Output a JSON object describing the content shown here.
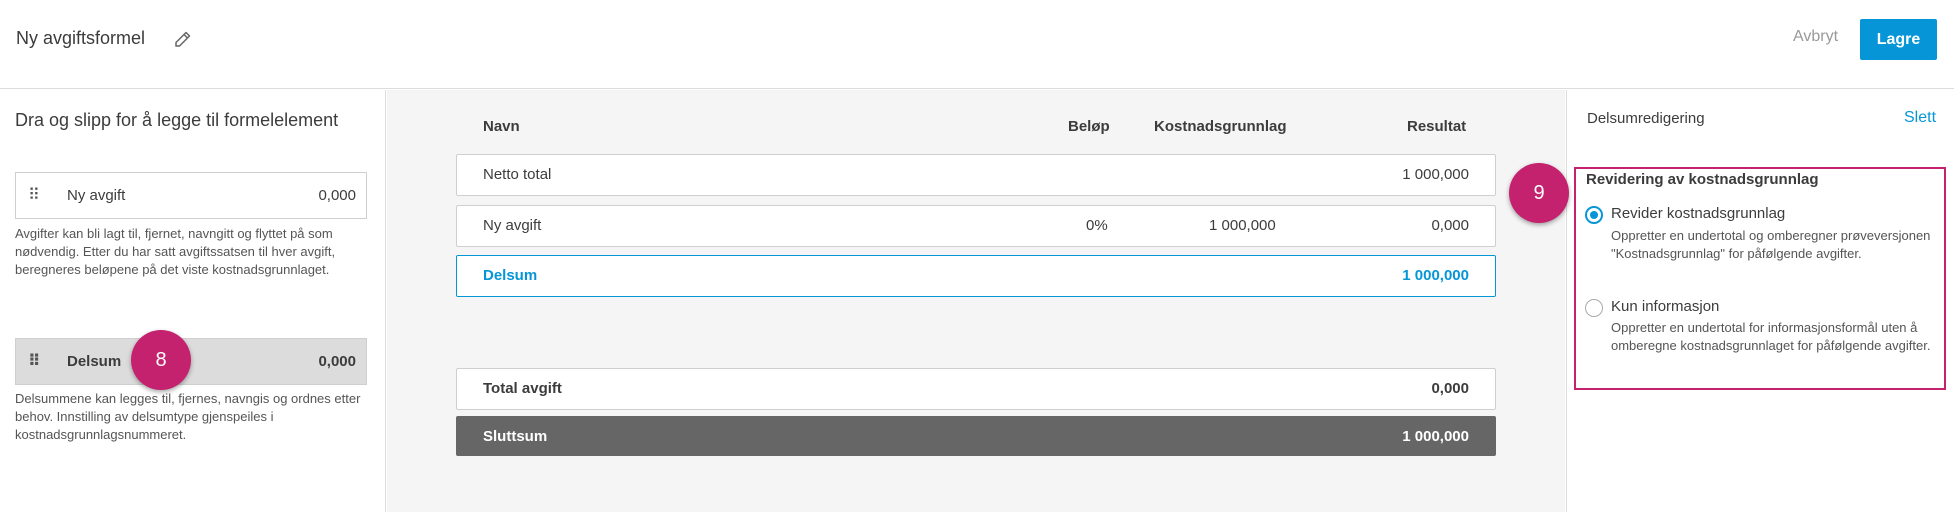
{
  "header": {
    "title": "Ny avgiftsformel",
    "edit_icon": "pencil-icon",
    "cancel_label": "Avbryt",
    "save_label": "Lagre"
  },
  "left_panel": {
    "heading": "Dra og slipp for å legge til formelelement",
    "items": [
      {
        "label": "Ny avgift",
        "value": "0,000",
        "description": "Avgifter kan bli lagt til, fjernet, navngitt og flyttet på som nødvendig. Etter du har satt avgiftssatsen til hver avgift, beregneres beløpene på det viste kostnadsgrunnlaget."
      },
      {
        "label": "Delsum",
        "value": "0,000",
        "description": "Delsummene kan legges til, fjernes, navngis og ordnes etter behov. Innstilling av delsumtype gjenspeiles i kostnadsgrunnlagsnummeret."
      }
    ],
    "badge": "8"
  },
  "table": {
    "headers": {
      "name": "Navn",
      "amount": "Beløp",
      "basis": "Kostnadsgrunnlag",
      "result": "Resultat"
    },
    "rows": [
      {
        "name": "Netto total",
        "amount": "",
        "basis": "",
        "result": "1 000,000"
      },
      {
        "name": "Ny avgift",
        "amount": "0%",
        "basis": "1 000,000",
        "result": "0,000"
      },
      {
        "name": "Delsum",
        "amount": "",
        "basis": "",
        "result": "1 000,000"
      }
    ],
    "total_fee": {
      "name": "Total avgift",
      "result": "0,000"
    },
    "grand_total": {
      "name": "Sluttsum",
      "result": "1 000,000"
    }
  },
  "right_panel": {
    "title": "Delsumredigering",
    "delete_label": "Slett",
    "badge": "9",
    "section_title": "Revidering av kostnadsgrunnlag",
    "options": [
      {
        "label": "Revider kostnadsgrunnlag",
        "description": "Oppretter en undertotal og omberegner prøveversjonen \"Kostnadsgrunnlag\" for påfølgende avgifter.",
        "selected": true
      },
      {
        "label": "Kun informasjon",
        "description": "Oppretter en undertotal for informasjonsformål uten å omberegne kostnadsgrunnlaget for påfølgende avgifter.",
        "selected": false
      }
    ]
  },
  "colors": {
    "accent": "#0696d7",
    "highlight": "#c4226e",
    "grand_total_bg": "#666666"
  }
}
